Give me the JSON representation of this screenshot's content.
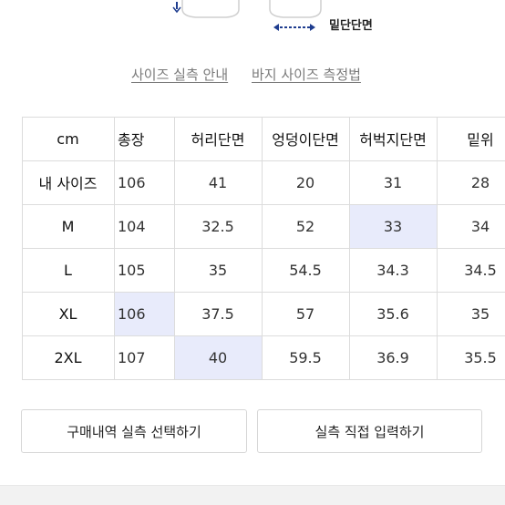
{
  "diagram": {
    "hem_label": "밑단단면"
  },
  "guide_links": {
    "size_guide": "사이즈 실측 안내",
    "pants_measure": "바지 사이즈 측정법"
  },
  "table": {
    "headers": [
      "cm",
      "총장",
      "허리단면",
      "엉덩이단면",
      "허벅지단면",
      "밑위"
    ],
    "rows": [
      {
        "label": "내 사이즈",
        "values": [
          "106",
          "41",
          "20",
          "31",
          "28"
        ]
      },
      {
        "label": "M",
        "values": [
          "104",
          "32.5",
          "52",
          "33",
          "34"
        ]
      },
      {
        "label": "L",
        "values": [
          "105",
          "35",
          "54.5",
          "34.3",
          "34.5"
        ]
      },
      {
        "label": "XL",
        "values": [
          "106",
          "37.5",
          "57",
          "35.6",
          "35"
        ]
      },
      {
        "label": "2XL",
        "values": [
          "107",
          "40",
          "59.5",
          "36.9",
          "35.5"
        ]
      }
    ]
  },
  "buttons": {
    "select_purchase": "구매내역 실측 선택하기",
    "direct_input": "실측 직접 입력하기"
  },
  "colors": {
    "highlight": "#e8ebfb",
    "arrow": "#1f3d8f"
  }
}
